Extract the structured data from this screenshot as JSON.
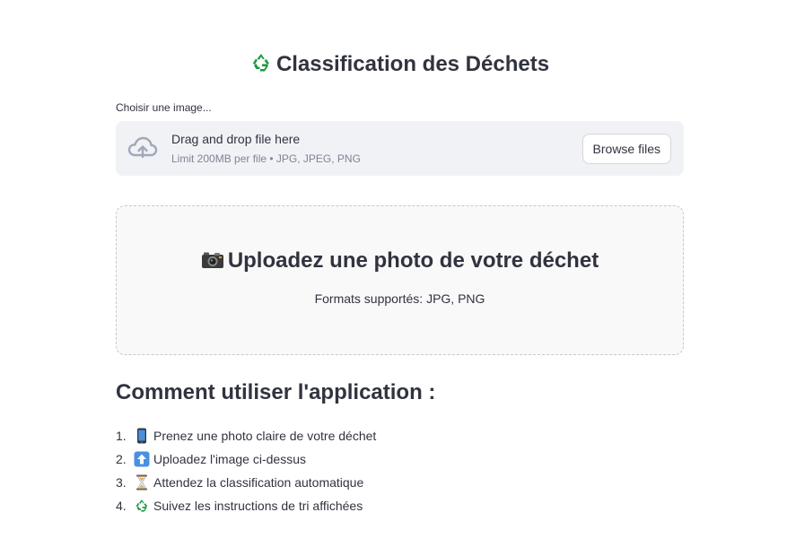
{
  "header": {
    "title": "Classification des Déchets",
    "title_icon": "recycle-icon"
  },
  "uploader": {
    "label": "Choisir une image...",
    "drop_text": "Drag and drop file here",
    "limit_text": "Limit 200MB per file • JPG, JPEG, PNG",
    "browse_label": "Browse files",
    "icon": "cloud-upload-icon"
  },
  "placeholder": {
    "title": "Uploadez une photo de votre déchet",
    "title_icon": "camera-icon",
    "subtitle": "Formats supportés: JPG, PNG"
  },
  "howto": {
    "title": "Comment utiliser l'application :",
    "steps": [
      {
        "num": "1.",
        "icon": "mobile-phone-icon",
        "text": "Prenez une photo claire de votre déchet"
      },
      {
        "num": "2.",
        "icon": "up-arrow-icon",
        "text": "Uploadez l'image ci-dessus"
      },
      {
        "num": "3.",
        "icon": "hourglass-icon",
        "text": "Attendez la classification automatique"
      },
      {
        "num": "4.",
        "icon": "recycle-icon",
        "text": "Suivez les instructions de tri affichées"
      }
    ]
  },
  "colors": {
    "text": "#31333f",
    "muted": "#808495",
    "dropzone_bg": "#f0f2f6",
    "recycle_green": "#1a9b3f"
  }
}
